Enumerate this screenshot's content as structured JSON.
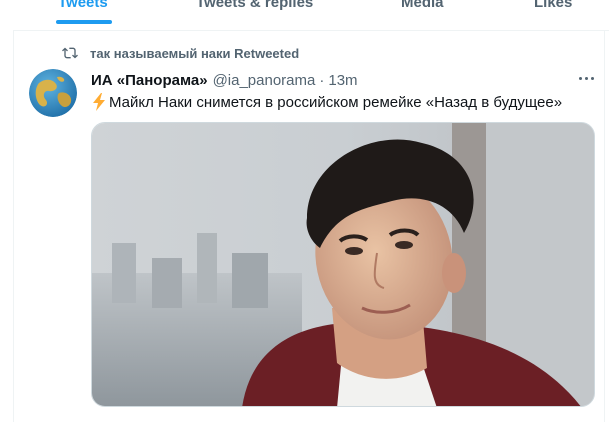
{
  "tabs": [
    {
      "label": "Tweets",
      "active": true
    },
    {
      "label": "Tweets & replies",
      "active": false
    },
    {
      "label": "Media",
      "active": false
    },
    {
      "label": "Likes",
      "active": false
    }
  ],
  "retweet": {
    "icon": "retweet-icon",
    "text": "так называемый наки Retweeted"
  },
  "tweet": {
    "author_name": "ИА «Панорама»",
    "handle": "@ia_panorama",
    "separator": "·",
    "time": "13m",
    "text": "Майкл Наки снимется в российском ремейке «Назад в будущее»",
    "emoji_icon": "lightning-bolt-icon",
    "avatar_icon": "globe-icon",
    "more_icon": "more-options-icon",
    "media": "photo"
  },
  "colors": {
    "accent": "#1d9bf0",
    "text": "#0f1419",
    "secondary_text": "#536471",
    "border": "#eff3f4"
  }
}
